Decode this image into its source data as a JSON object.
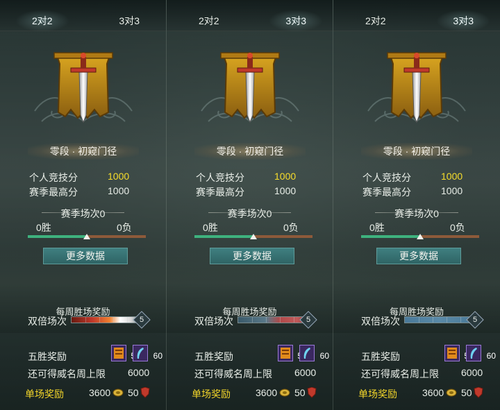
{
  "panels": [
    {
      "tabs": {
        "left": "2对2",
        "right": "3对3",
        "active": "left"
      },
      "rank": "零段 · 初窥门径",
      "stats": {
        "personal_label": "个人竞技分",
        "personal_value": "1000",
        "season_max_label": "赛季最高分",
        "season_max_value": "1000"
      },
      "season": {
        "title": "赛季场次0",
        "wins": "0胜",
        "losses": "0负",
        "win_ratio": 0.5
      },
      "more_button": "更多数据",
      "weekly": {
        "title": "每周胜场奖励",
        "double_label": "双倍场次",
        "double_count": "5",
        "double_style": "fire"
      },
      "five_win": {
        "label": "五胜奖励",
        "item1_count": "5",
        "item2_count": "60"
      },
      "cap": {
        "label": "还可得威名周上限",
        "value": "6000"
      },
      "single": {
        "label": "单场奖励",
        "coin_value": "3600",
        "fame_value": "50"
      }
    },
    {
      "tabs": {
        "left": "2对2",
        "right": "3对3",
        "active": "right"
      },
      "rank": "零段 · 初窥门径",
      "stats": {
        "personal_label": "个人竞技分",
        "personal_value": "1000",
        "season_max_label": "赛季最高分",
        "season_max_value": "1000"
      },
      "season": {
        "title": "赛季场次0",
        "wins": "0胜",
        "losses": "0负",
        "win_ratio": 0.5
      },
      "more_button": "更多数据",
      "weekly": {
        "title": "每周胜场奖励",
        "double_label": "双倍场次",
        "double_count": "5",
        "double_style": "red"
      },
      "five_win": {
        "label": "五胜奖励",
        "item1_count": "5",
        "item2_count": "60"
      },
      "cap": {
        "label": "还可得威名周上限",
        "value": "6000"
      },
      "single": {
        "label": "单场奖励",
        "coin_value": "3600",
        "fame_value": "50"
      }
    },
    {
      "tabs": {
        "left": "2对2",
        "right": "3对3",
        "active": "right"
      },
      "rank": "零段 · 初窥门径",
      "stats": {
        "personal_label": "个人竞技分",
        "personal_value": "1000",
        "season_max_label": "赛季最高分",
        "season_max_value": "1000"
      },
      "season": {
        "title": "赛季场次0",
        "wins": "0胜",
        "losses": "0负",
        "win_ratio": 0.5
      },
      "more_button": "更多数据",
      "weekly": {
        "title": "每周胜场奖励",
        "double_label": "双倍场次",
        "double_count": "5",
        "double_style": "blue"
      },
      "five_win": {
        "label": "五胜奖励",
        "item1_count": "5",
        "item2_count": "60"
      },
      "cap": {
        "label": "还可得威名周上限",
        "value": "6000"
      },
      "single": {
        "label": "单场奖励",
        "coin_value": "3600",
        "fame_value": "50"
      }
    }
  ],
  "colors": {
    "score": "#f7dd2b",
    "single_label": "#f3d62a",
    "win": "#3eb27e",
    "loss": "#8d5a3a",
    "button": "#3f7f80"
  }
}
